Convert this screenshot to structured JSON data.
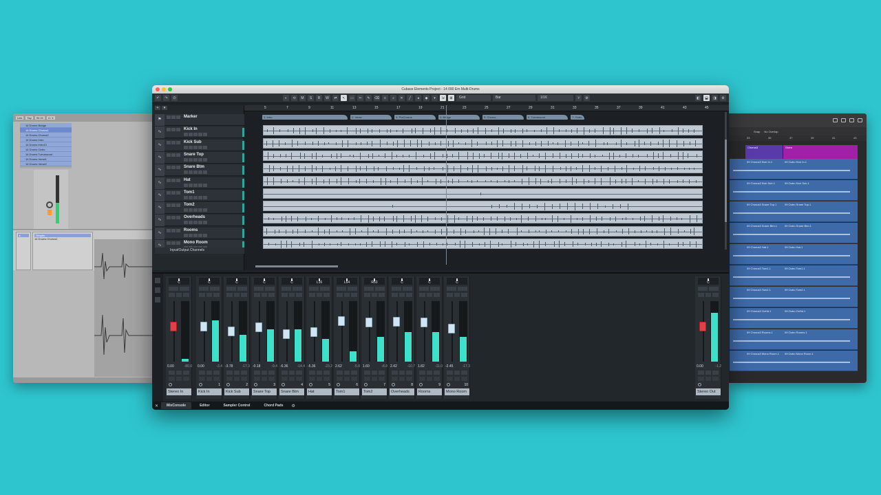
{
  "main_window": {
    "title": "Cubase Elements Project - 14 090 Em Multi-Drums",
    "toolbar": {
      "mode_buttons": [
        "M",
        "S",
        "R",
        "W"
      ],
      "snap_type": "Grid",
      "grid": "Bar",
      "quantize": "1/16"
    },
    "ruler": [
      "5",
      "7",
      "9",
      "11",
      "13",
      "15",
      "17",
      "19",
      "21",
      "23",
      "25",
      "27",
      "29",
      "31",
      "33",
      "35",
      "37",
      "39",
      "41",
      "43",
      "45"
    ],
    "markers": [
      "1: Intro",
      "2: Verse",
      "3: PreChorus",
      "4: Bridge",
      "5: Chorus",
      "6: Turnaround",
      "7: Outro"
    ],
    "tracks": [
      {
        "name": "Marker",
        "icon": "marker-icon"
      },
      {
        "name": "Kick In",
        "icon": "waveform-icon"
      },
      {
        "name": "Kick Sub",
        "icon": "waveform-icon"
      },
      {
        "name": "Snare Top",
        "icon": "waveform-icon"
      },
      {
        "name": "Snare Btm",
        "icon": "waveform-icon"
      },
      {
        "name": "Hat",
        "icon": "waveform-icon"
      },
      {
        "name": "Tom1",
        "icon": "waveform-icon"
      },
      {
        "name": "Tom2",
        "icon": "waveform-icon"
      },
      {
        "name": "Overheads",
        "icon": "waveform-icon"
      },
      {
        "name": "Rooms",
        "icon": "waveform-icon"
      },
      {
        "name": "Mono Room",
        "icon": "waveform-icon"
      }
    ],
    "io_channels_label": "Input/Output Channels",
    "mixer": {
      "channels": [
        {
          "label": "Stereo In",
          "pan": "C",
          "vol": "0.00",
          "peak": "-80.0",
          "num": "",
          "fader": 0.6,
          "meter": 0.05
        },
        {
          "label": "Kick In",
          "pan": "C",
          "vol": "0.00",
          "peak": "-3.4",
          "num": "1",
          "fader": 0.6,
          "meter": 0.7
        },
        {
          "label": "Kick Sub",
          "pan": "C",
          "vol": "-3.78",
          "peak": "-17.3",
          "num": "2",
          "fader": 0.5,
          "meter": 0.45
        },
        {
          "label": "Snare Top",
          "pan": "C",
          "vol": "-0.18",
          "peak": "-9.4",
          "num": "3",
          "fader": 0.58,
          "meter": 0.55
        },
        {
          "label": "Snare Btm",
          "pan": "C",
          "vol": "-6.36",
          "peak": "-14.4",
          "num": "4",
          "fader": 0.45,
          "meter": 0.55
        },
        {
          "label": "Hat",
          "pan": "L16",
          "vol": "-5.36",
          "peak": "-23.2",
          "num": "5",
          "fader": 0.48,
          "meter": 0.38
        },
        {
          "label": "Tom1",
          "pan": "L64",
          "vol": "2.62",
          "peak": "-5.8",
          "num": "6",
          "fader": 0.7,
          "meter": 0.18
        },
        {
          "label": "Tom2",
          "pan": "R63",
          "vol": "1.60",
          "peak": "-8.8",
          "num": "7",
          "fader": 0.67,
          "meter": 0.42
        },
        {
          "label": "Overheads",
          "pan": "C",
          "vol": "2.42",
          "peak": "-10.7",
          "num": "8",
          "fader": 0.69,
          "meter": 0.5
        },
        {
          "label": "Rooms",
          "pan": "C",
          "vol": "1.82",
          "peak": "-11.0",
          "num": "9",
          "fader": 0.67,
          "meter": 0.5
        },
        {
          "label": "Mono Room",
          "pan": "C",
          "vol": "-2.45",
          "peak": "-17.3",
          "num": "10",
          "fader": 0.55,
          "meter": 0.42
        }
      ],
      "output": {
        "label": "Stereo Out",
        "pan": "C",
        "vol": "0.00",
        "peak": "-1.2",
        "num": "",
        "fader": 0.6,
        "meter": 0.82
      }
    },
    "bottom_tabs": [
      "MixConsole",
      "Editor",
      "Sampler Control",
      "Chord Pads"
    ]
  },
  "left_window": {
    "browser_items": [
      "14 Drums Bridge",
      "14 Drums Chorus1",
      "14 Drums Chorus2",
      "14 Drums Intro",
      "14 Drums Intro10",
      "14 Drums Outro",
      "14 Drums Turnaround",
      "14 Drums Verse1",
      "14 Drums Verse2"
    ],
    "device_header": "Simpler",
    "device_title": "14 Drums Chorus1"
  },
  "right_window": {
    "toolbar_labels": [
      "Snap",
      "No Overlap"
    ],
    "ruler": [
      "33",
      "35",
      "37",
      "39",
      "41",
      "43"
    ],
    "sections": [
      {
        "label": "Chorus3",
        "color": "#5a3aa8"
      },
      {
        "label": "Outro",
        "color": "#a020a8"
      }
    ],
    "regions": [
      [
        "09 Chorus3 Kick In.1",
        "09 Outro Kick In.1"
      ],
      [
        "09 Chorus3 Kick Sub.1",
        "09 Outro Kick Sub.1"
      ],
      [
        "09 Chorus3 Snare Top.1",
        "09 Outro Snare Top.1"
      ],
      [
        "09 Chorus3 Snare Btm.1",
        "09 Outro Snare Btm.1"
      ],
      [
        "09 Chorus3 Hat.1",
        "09 Outro Hat.1"
      ],
      [
        "09 Chorus3 Tom1.1",
        "09 Outro Tom1.1"
      ],
      [
        "09 Chorus3 Tom2.1",
        "09 Outro Tom2.1"
      ],
      [
        "09 Chorus3 OvHd.1",
        "09 Outro OvHd.1"
      ],
      [
        "09 Chorus3 Rooms.1",
        "09 Outro Rooms.1"
      ],
      [
        "09 Chorus3 Mono Room.1",
        "09 Outro Mono Room.1"
      ]
    ]
  },
  "colors": {
    "background": "#2ec5cf",
    "meter": "#3fe0c9",
    "clip": "#c0c9d2",
    "logic_region": "#3e6aa8"
  }
}
